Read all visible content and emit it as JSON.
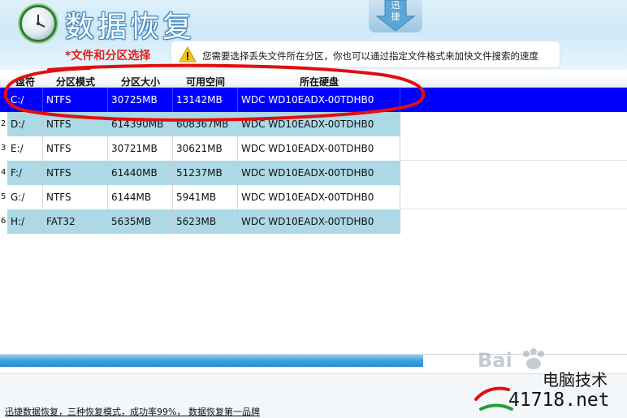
{
  "header": {
    "app_title": "数据恢复",
    "quick_button_label": "迅捷",
    "step_label": "*文件和分区选择",
    "hint": "您需要选择丢失文件所在分区，你也可以通过指定文件格式来加快文件搜索的速度"
  },
  "table": {
    "columns": [
      "盘符",
      "分区模式",
      "分区大小",
      "可用空间",
      "所在硬盘"
    ],
    "rows": [
      {
        "num": "",
        "drive": "C:/",
        "mode": "NTFS",
        "size": "30725MB",
        "free": "13142MB",
        "disk": "WDC WD10EADX-00TDHB0",
        "selected": true
      },
      {
        "num": "2",
        "drive": "D:/",
        "mode": "NTFS",
        "size": "614390MB",
        "free": "608367MB",
        "disk": "WDC WD10EADX-00TDHB0",
        "selected": false
      },
      {
        "num": "3",
        "drive": "E:/",
        "mode": "NTFS",
        "size": "30721MB",
        "free": "30621MB",
        "disk": "WDC WD10EADX-00TDHB0",
        "selected": false
      },
      {
        "num": "4",
        "drive": "F:/",
        "mode": "NTFS",
        "size": "61440MB",
        "free": "51237MB",
        "disk": "WDC WD10EADX-00TDHB0",
        "selected": false
      },
      {
        "num": "5",
        "drive": "G:/",
        "mode": "NTFS",
        "size": "6144MB",
        "free": "5941MB",
        "disk": "WDC WD10EADX-00TDHB0",
        "selected": false
      },
      {
        "num": "6",
        "drive": "H:/",
        "mode": "FAT32",
        "size": "5635MB",
        "free": "5623MB",
        "disk": "WDC WD10EADX-00TDHB0",
        "selected": false
      }
    ]
  },
  "progress": {
    "value": 0.675
  },
  "footer": {
    "text": "迅捷数据恢复，三种恢复模式，成功率99%， 数据恢复第一品牌"
  },
  "watermark": {
    "baidu": "Bai",
    "site_name": "电脑技术",
    "site_url": "41718.net"
  },
  "colors": {
    "selected_row": "#0000ff",
    "alt_row": "#add8e6",
    "annotation": "#e01010",
    "step_label": "#e02020"
  },
  "icons": {
    "app": "clock-icon",
    "quick": "down-arrow-icon",
    "hint": "warning-icon"
  }
}
